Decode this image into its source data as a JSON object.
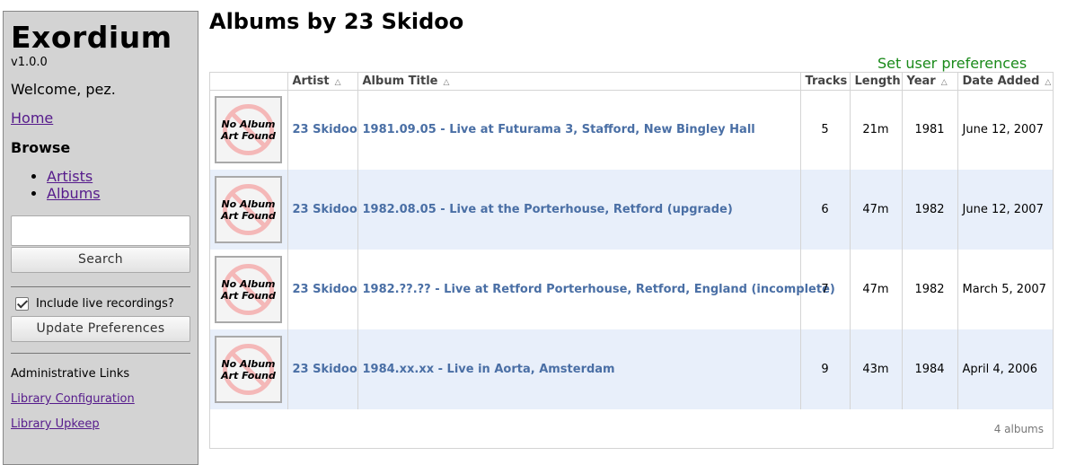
{
  "sidebar": {
    "app_title": "Exordium",
    "version": "v1.0.0",
    "welcome": "Welcome, pez.",
    "home_label": "Home",
    "browse_heading": "Browse",
    "browse_items": [
      {
        "label": "Artists"
      },
      {
        "label": "Albums"
      }
    ],
    "search_value": "",
    "search_button": "Search",
    "live_checkbox_label": "Include live recordings?",
    "live_checkbox_checked": true,
    "update_button": "Update Preferences",
    "admin_heading": "Administrative Links",
    "admin_links": [
      {
        "label": "Library Configuration"
      },
      {
        "label": "Library Upkeep"
      }
    ]
  },
  "main": {
    "page_title": "Albums by 23 Skidoo",
    "prefs_link": "Set user preferences",
    "table": {
      "columns": [
        "",
        "Artist",
        "Album Title",
        "Tracks",
        "Length",
        "Year",
        "Date Added"
      ],
      "sortable": [
        false,
        true,
        true,
        false,
        false,
        true,
        true
      ],
      "art_placeholder_line1": "No Album",
      "art_placeholder_line2": "Art Found",
      "rows": [
        {
          "artist": "23 Skidoo",
          "album": "1981.09.05 - Live at Futurama 3, Stafford, New Bingley Hall",
          "tracks": "5",
          "length": "21m",
          "year": "1981",
          "date_added": "June 12, 2007"
        },
        {
          "artist": "23 Skidoo",
          "album": "1982.08.05 - Live at the Porterhouse, Retford (upgrade)",
          "tracks": "6",
          "length": "47m",
          "year": "1982",
          "date_added": "June 12, 2007"
        },
        {
          "artist": "23 Skidoo",
          "album": "1982.??.?? - Live at Retford Porterhouse, Retford, England (incomplete)",
          "tracks": "7",
          "length": "47m",
          "year": "1982",
          "date_added": "March 5, 2007"
        },
        {
          "artist": "23 Skidoo",
          "album": "1984.xx.xx - Live in Aorta, Amsterdam",
          "tracks": "9",
          "length": "43m",
          "year": "1984",
          "date_added": "April 4, 2006"
        }
      ],
      "count_text": "4 albums"
    }
  },
  "colors": {
    "sidebar_bg": "#d3d3d3",
    "link_visited": "#551a8b",
    "table_link": "#4a6fa5",
    "prefs_link": "#1a8a1a",
    "row_alt_bg": "#e8effa"
  }
}
